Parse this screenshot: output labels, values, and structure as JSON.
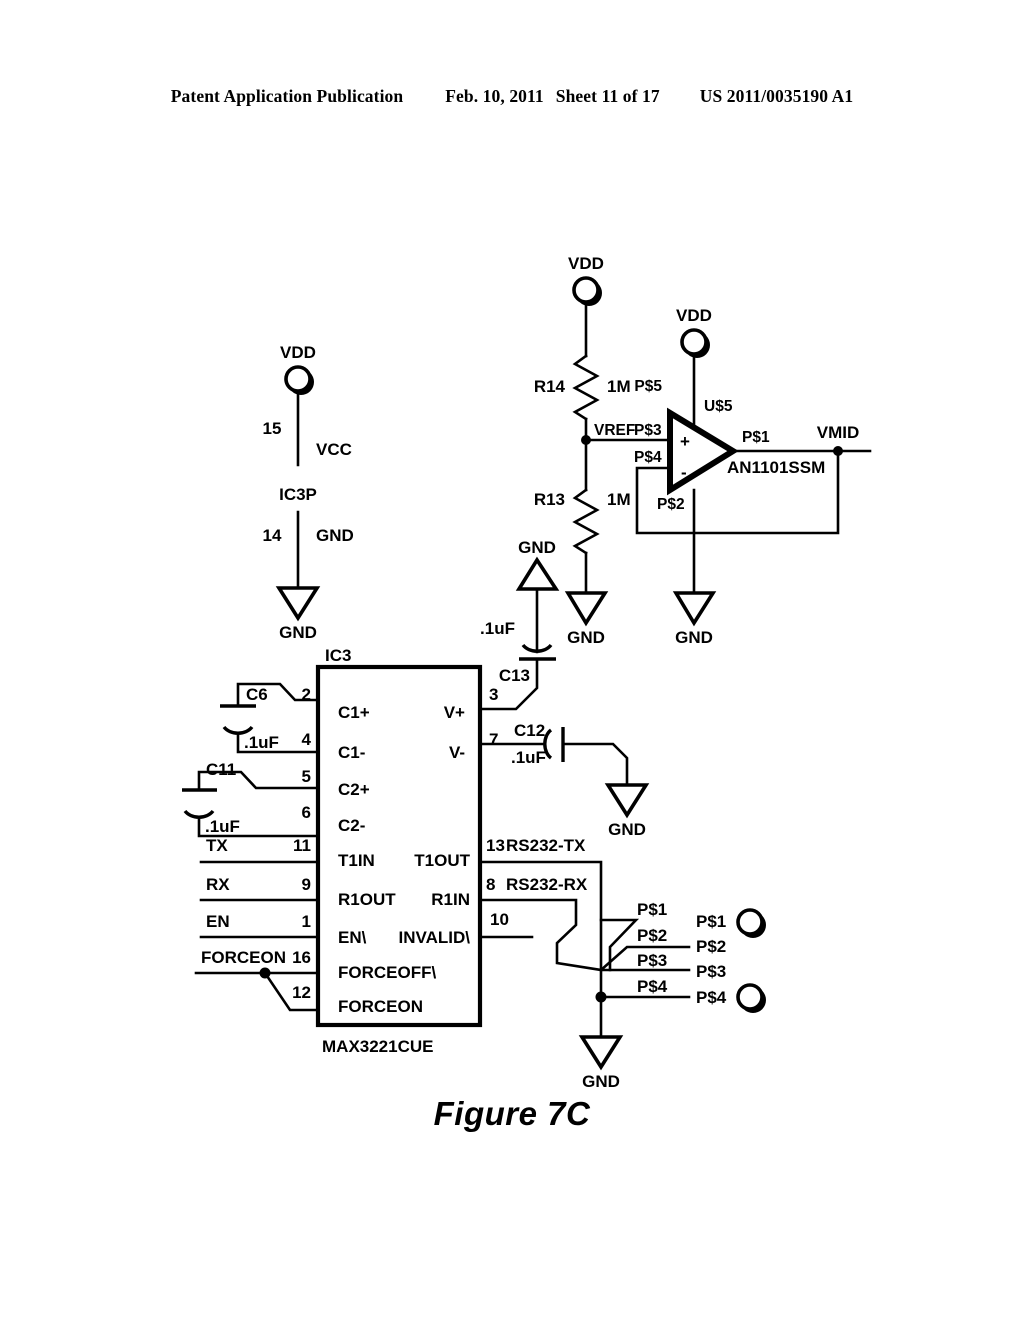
{
  "header": {
    "publication": "Patent Application Publication",
    "date": "Feb. 10, 2011",
    "sheet": "Sheet 11 of 17",
    "docnum": "US 2011/0035190 A1"
  },
  "figure": {
    "caption": "Figure 7C"
  },
  "power_block": {
    "vdd_label": "VDD",
    "pin_15": "15",
    "vcc_label": "VCC",
    "device": "IC3P",
    "pin_14": "14",
    "gnd_pin_label": "GND",
    "gnd_symbol_label": "GND"
  },
  "divider": {
    "vdd_label": "VDD",
    "r14_name": "R14",
    "r14_value": "1M",
    "vref_label": "VREF",
    "r13_name": "R13",
    "r13_value": "1M",
    "gnd_label": "GND"
  },
  "opamp": {
    "vdd_label": "VDD",
    "refdes": "U$5",
    "part": "AN1101SSM",
    "pin_p5": "P$5",
    "pin_p3": "P$3",
    "pin_p4": "P$4",
    "pin_p2": "P$2",
    "pin_p1": "P$1",
    "plus": "+",
    "minus": "-",
    "output_net": "VMID",
    "gnd_label": "GND"
  },
  "decoupling": {
    "c13_name": "C13",
    "c13_value": ".1uF",
    "c13_gnd": "GND",
    "c12_name": "C12",
    "c12_value": ".1uF",
    "c12_gnd": "GND",
    "c6_name": "C6",
    "c6_value": ".1uF",
    "c11_name": "C11",
    "c11_value": ".1uF"
  },
  "ic3": {
    "refdes": "IC3",
    "part": "MAX3221CUE",
    "left_pins": [
      {
        "number": "2",
        "name": "C1+",
        "net": ""
      },
      {
        "number": "4",
        "name": "C1-",
        "net": ""
      },
      {
        "number": "5",
        "name": "C2+",
        "net": ""
      },
      {
        "number": "6",
        "name": "C2-",
        "net": ""
      },
      {
        "number": "11",
        "name": "T1IN",
        "net": "TX"
      },
      {
        "number": "9",
        "name": "R1OUT",
        "net": "RX"
      },
      {
        "number": "1",
        "name": "EN\\",
        "net": "EN"
      },
      {
        "number": "16",
        "name": "FORCEOFF\\",
        "net": "FORCEON"
      },
      {
        "number": "12",
        "name": "FORCEON",
        "net": ""
      }
    ],
    "right_pins": [
      {
        "number": "3",
        "name": "V+",
        "net": ""
      },
      {
        "number": "7",
        "name": "V-",
        "net": ""
      },
      {
        "number": "13",
        "name": "T1OUT",
        "net": "RS232-TX"
      },
      {
        "number": "8",
        "name": "R1IN",
        "net": "RS232-RX"
      },
      {
        "number": "10",
        "name": "INVALID\\",
        "net": ""
      }
    ]
  },
  "connector": {
    "wire_labels": [
      "P$1",
      "P$2",
      "P$3",
      "P$4"
    ],
    "pad_labels": [
      "P$1",
      "P$2",
      "P$3",
      "P$4"
    ],
    "gnd_label": "GND"
  }
}
